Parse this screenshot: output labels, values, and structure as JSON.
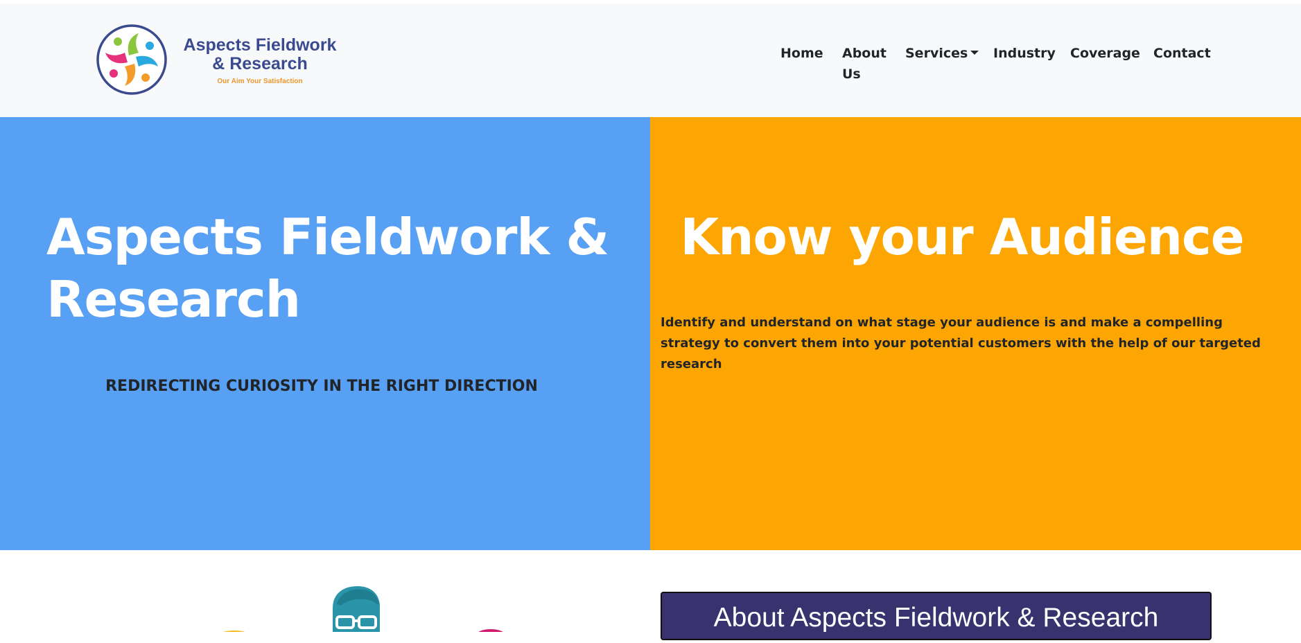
{
  "brand": {
    "name_line1": "Aspects Fieldwork",
    "name_line2": "& Research",
    "tagline": "Our Aim Your Satisfaction",
    "colors": {
      "primary": "#3a4a8f",
      "accent": "#e8982e"
    }
  },
  "nav": {
    "items": [
      {
        "label": "Home"
      },
      {
        "label": "About Us"
      },
      {
        "label": "Services",
        "has_dropdown": true
      },
      {
        "label": "Industry"
      },
      {
        "label": "Coverage"
      },
      {
        "label": "Contact"
      }
    ]
  },
  "hero": {
    "left": {
      "title": "Aspects Fieldwork & Research",
      "subtitle": "REDIRECTING CURIOSITY IN THE RIGHT DIRECTION",
      "bg_color": "#57a0f4"
    },
    "right": {
      "title": "Know your Audience",
      "text": "Identify and understand on what stage your audience is and make a compelling strategy to convert them into your potential customers with the help of our targeted research",
      "bg_color": "#fca503"
    }
  },
  "about": {
    "heading": "About Aspects Fieldwork & Research",
    "bg_color": "#38336f"
  },
  "icons": [
    "logo-emblem-icon",
    "dropdown-caret-icon",
    "person-with-glasses-illustration"
  ]
}
